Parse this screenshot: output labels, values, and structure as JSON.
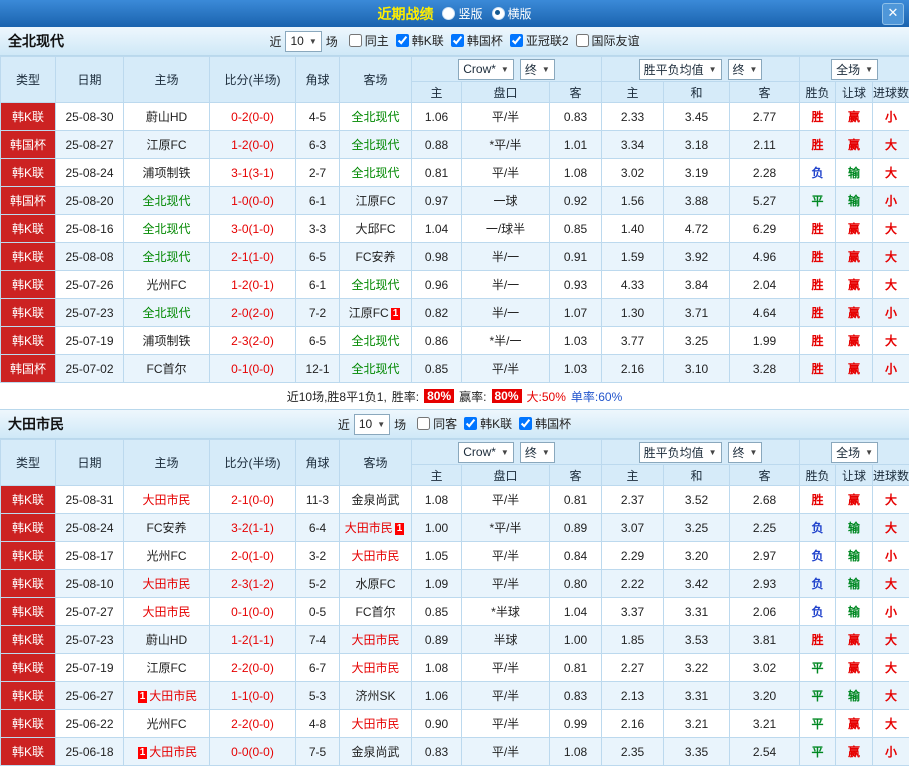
{
  "topbar": {
    "title": "近期战绩",
    "layout_options": [
      {
        "label": "竖版",
        "selected": false
      },
      {
        "label": "横版",
        "selected": true
      }
    ],
    "close_label": "✕"
  },
  "controls": {
    "near_label": "近",
    "count_value": "10",
    "games_label": "场",
    "bookmaker_select": "Crow*",
    "final_select": "终",
    "avg_select": "胜平负均值",
    "scope_select": "全场"
  },
  "table_columns": {
    "type": "类型",
    "date": "日期",
    "home": "主场",
    "score": "比分(半场)",
    "corner": "角球",
    "away": "客场",
    "odds_home": "主",
    "handicap": "盘口",
    "odds_away": "客",
    "avg_home": "主",
    "avg_draw": "和",
    "avg_away": "客",
    "result": "胜负",
    "handicap_result": "让球",
    "goals_result": "进球数"
  },
  "misc": {
    "red_card_label": "1"
  },
  "colors": {
    "result_map": {
      "胜": "#e60000",
      "平": "#008822",
      "负": "#2244cc",
      "赢": "#e60000",
      "输": "#008822",
      "大": "#e60000",
      "小": "#e60000"
    },
    "focus_team1": "#008800",
    "focus_team2": "#e60000"
  },
  "team1": {
    "name": "全北现代",
    "filters": [
      {
        "label": "同主",
        "checked": false
      },
      {
        "label": "韩K联",
        "checked": true
      },
      {
        "label": "韩国杯",
        "checked": true
      },
      {
        "label": "亚冠联2",
        "checked": true
      },
      {
        "label": "国际友谊",
        "checked": false
      }
    ],
    "rows": [
      {
        "type": "韩K联",
        "date": "25-08-30",
        "home": "蔚山HD",
        "home_focus": false,
        "home_card": false,
        "score": "0-2(0-0)",
        "corner": "4-5",
        "away": "全北现代",
        "away_focus": true,
        "away_card": false,
        "odds": [
          "1.06",
          "平/半",
          "0.83",
          "2.33",
          "3.45",
          "2.77"
        ],
        "results": [
          "胜",
          "赢",
          "小"
        ]
      },
      {
        "type": "韩国杯",
        "date": "25-08-27",
        "home": "江原FC",
        "home_focus": false,
        "home_card": false,
        "score": "1-2(0-0)",
        "corner": "6-3",
        "away": "全北现代",
        "away_focus": true,
        "away_card": false,
        "odds": [
          "0.88",
          "*平/半",
          "1.01",
          "3.34",
          "3.18",
          "2.11"
        ],
        "results": [
          "胜",
          "赢",
          "大"
        ]
      },
      {
        "type": "韩K联",
        "date": "25-08-24",
        "home": "浦项制铁",
        "home_focus": false,
        "home_card": false,
        "score": "3-1(3-1)",
        "corner": "2-7",
        "away": "全北现代",
        "away_focus": true,
        "away_card": false,
        "odds": [
          "0.81",
          "平/半",
          "1.08",
          "3.02",
          "3.19",
          "2.28"
        ],
        "results": [
          "负",
          "输",
          "大"
        ]
      },
      {
        "type": "韩国杯",
        "date": "25-08-20",
        "home": "全北现代",
        "home_focus": true,
        "home_card": false,
        "score": "1-0(0-0)",
        "corner": "6-1",
        "away": "江原FC",
        "away_focus": false,
        "away_card": false,
        "odds": [
          "0.97",
          "一球",
          "0.92",
          "1.56",
          "3.88",
          "5.27"
        ],
        "results": [
          "平",
          "输",
          "小"
        ]
      },
      {
        "type": "韩K联",
        "date": "25-08-16",
        "home": "全北现代",
        "home_focus": true,
        "home_card": false,
        "score": "3-0(1-0)",
        "corner": "3-3",
        "away": "大邱FC",
        "away_focus": false,
        "away_card": false,
        "odds": [
          "1.04",
          "一/球半",
          "0.85",
          "1.40",
          "4.72",
          "6.29"
        ],
        "results": [
          "胜",
          "赢",
          "大"
        ]
      },
      {
        "type": "韩K联",
        "date": "25-08-08",
        "home": "全北现代",
        "home_focus": true,
        "home_card": false,
        "score": "2-1(1-0)",
        "corner": "6-5",
        "away": "FC安养",
        "away_focus": false,
        "away_card": false,
        "odds": [
          "0.98",
          "半/一",
          "0.91",
          "1.59",
          "3.92",
          "4.96"
        ],
        "results": [
          "胜",
          "赢",
          "大"
        ]
      },
      {
        "type": "韩K联",
        "date": "25-07-26",
        "home": "光州FC",
        "home_focus": false,
        "home_card": false,
        "score": "1-2(0-1)",
        "corner": "6-1",
        "away": "全北现代",
        "away_focus": true,
        "away_card": false,
        "odds": [
          "0.96",
          "半/一",
          "0.93",
          "4.33",
          "3.84",
          "2.04"
        ],
        "results": [
          "胜",
          "赢",
          "大"
        ]
      },
      {
        "type": "韩K联",
        "date": "25-07-23",
        "home": "全北现代",
        "home_focus": true,
        "home_card": false,
        "score": "2-0(2-0)",
        "corner": "7-2",
        "away": "江原FC",
        "away_focus": false,
        "away_card": true,
        "odds": [
          "0.82",
          "半/一",
          "1.07",
          "1.30",
          "3.71",
          "4.64"
        ],
        "results": [
          "胜",
          "赢",
          "小"
        ]
      },
      {
        "type": "韩K联",
        "date": "25-07-19",
        "home": "浦项制铁",
        "home_focus": false,
        "home_card": false,
        "score": "2-3(2-0)",
        "corner": "6-5",
        "away": "全北现代",
        "away_focus": true,
        "away_card": false,
        "odds": [
          "0.86",
          "*半/一",
          "1.03",
          "3.77",
          "3.25",
          "1.99"
        ],
        "results": [
          "胜",
          "赢",
          "大"
        ]
      },
      {
        "type": "韩国杯",
        "date": "25-07-02",
        "home": "FC首尔",
        "home_focus": false,
        "home_card": false,
        "score": "0-1(0-0)",
        "corner": "12-1",
        "away": "全北现代",
        "away_focus": true,
        "away_card": false,
        "odds": [
          "0.85",
          "平/半",
          "1.03",
          "2.16",
          "3.10",
          "3.28"
        ],
        "results": [
          "胜",
          "赢",
          "小"
        ]
      }
    ],
    "summary": {
      "prefix": "近10场,胜8平1负1,",
      "win_rate_label": "胜率:",
      "win_rate": "80%",
      "profit_label": "赢率:",
      "profit_rate": "80%",
      "big_rate": "大:50%",
      "single_rate": "单率:60%"
    }
  },
  "team2": {
    "name": "大田市民",
    "filters": [
      {
        "label": "同客",
        "checked": false
      },
      {
        "label": "韩K联",
        "checked": true
      },
      {
        "label": "韩国杯",
        "checked": true
      }
    ],
    "rows": [
      {
        "type": "韩K联",
        "date": "25-08-31",
        "home": "大田市民",
        "home_focus": true,
        "home_card": false,
        "score": "2-1(0-0)",
        "corner": "11-3",
        "away": "金泉尚武",
        "away_focus": false,
        "away_card": false,
        "odds": [
          "1.08",
          "平/半",
          "0.81",
          "2.37",
          "3.52",
          "2.68"
        ],
        "results": [
          "胜",
          "赢",
          "大"
        ]
      },
      {
        "type": "韩K联",
        "date": "25-08-24",
        "home": "FC安养",
        "home_focus": false,
        "home_card": false,
        "score": "3-2(1-1)",
        "corner": "6-4",
        "away": "大田市民",
        "away_focus": true,
        "away_card": true,
        "odds": [
          "1.00",
          "*平/半",
          "0.89",
          "3.07",
          "3.25",
          "2.25"
        ],
        "results": [
          "负",
          "输",
          "大"
        ]
      },
      {
        "type": "韩K联",
        "date": "25-08-17",
        "home": "光州FC",
        "home_focus": false,
        "home_card": false,
        "score": "2-0(1-0)",
        "corner": "3-2",
        "away": "大田市民",
        "away_focus": true,
        "away_card": false,
        "odds": [
          "1.05",
          "平/半",
          "0.84",
          "2.29",
          "3.20",
          "2.97"
        ],
        "results": [
          "负",
          "输",
          "小"
        ]
      },
      {
        "type": "韩K联",
        "date": "25-08-10",
        "home": "大田市民",
        "home_focus": true,
        "home_card": false,
        "score": "2-3(1-2)",
        "corner": "5-2",
        "away": "水原FC",
        "away_focus": false,
        "away_card": false,
        "odds": [
          "1.09",
          "平/半",
          "0.80",
          "2.22",
          "3.42",
          "2.93"
        ],
        "results": [
          "负",
          "输",
          "大"
        ]
      },
      {
        "type": "韩K联",
        "date": "25-07-27",
        "home": "大田市民",
        "home_focus": true,
        "home_card": false,
        "score": "0-1(0-0)",
        "corner": "0-5",
        "away": "FC首尔",
        "away_focus": false,
        "away_card": false,
        "odds": [
          "0.85",
          "*半球",
          "1.04",
          "3.37",
          "3.31",
          "2.06"
        ],
        "results": [
          "负",
          "输",
          "小"
        ]
      },
      {
        "type": "韩K联",
        "date": "25-07-23",
        "home": "蔚山HD",
        "home_focus": false,
        "home_card": false,
        "score": "1-2(1-1)",
        "corner": "7-4",
        "away": "大田市民",
        "away_focus": true,
        "away_card": false,
        "odds": [
          "0.89",
          "半球",
          "1.00",
          "1.85",
          "3.53",
          "3.81"
        ],
        "results": [
          "胜",
          "赢",
          "大"
        ]
      },
      {
        "type": "韩K联",
        "date": "25-07-19",
        "home": "江原FC",
        "home_focus": false,
        "home_card": false,
        "score": "2-2(0-0)",
        "corner": "6-7",
        "away": "大田市民",
        "away_focus": true,
        "away_card": false,
        "odds": [
          "1.08",
          "平/半",
          "0.81",
          "2.27",
          "3.22",
          "3.02"
        ],
        "results": [
          "平",
          "赢",
          "大"
        ]
      },
      {
        "type": "韩K联",
        "date": "25-06-27",
        "home": "大田市民",
        "home_focus": true,
        "home_card": true,
        "score": "1-1(0-0)",
        "corner": "5-3",
        "away": "济州SK",
        "away_focus": false,
        "away_card": false,
        "odds": [
          "1.06",
          "平/半",
          "0.83",
          "2.13",
          "3.31",
          "3.20"
        ],
        "results": [
          "平",
          "输",
          "大"
        ]
      },
      {
        "type": "韩K联",
        "date": "25-06-22",
        "home": "光州FC",
        "home_focus": false,
        "home_card": false,
        "score": "2-2(0-0)",
        "corner": "4-8",
        "away": "大田市民",
        "away_focus": true,
        "away_card": false,
        "odds": [
          "0.90",
          "平/半",
          "0.99",
          "2.16",
          "3.21",
          "3.21"
        ],
        "results": [
          "平",
          "赢",
          "大"
        ]
      },
      {
        "type": "韩K联",
        "date": "25-06-18",
        "home": "大田市民",
        "home_focus": true,
        "home_card": true,
        "score": "0-0(0-0)",
        "corner": "7-5",
        "away": "金泉尚武",
        "away_focus": false,
        "away_card": false,
        "odds": [
          "0.83",
          "平/半",
          "1.08",
          "2.35",
          "3.35",
          "2.54"
        ],
        "results": [
          "平",
          "赢",
          "小"
        ]
      }
    ]
  }
}
